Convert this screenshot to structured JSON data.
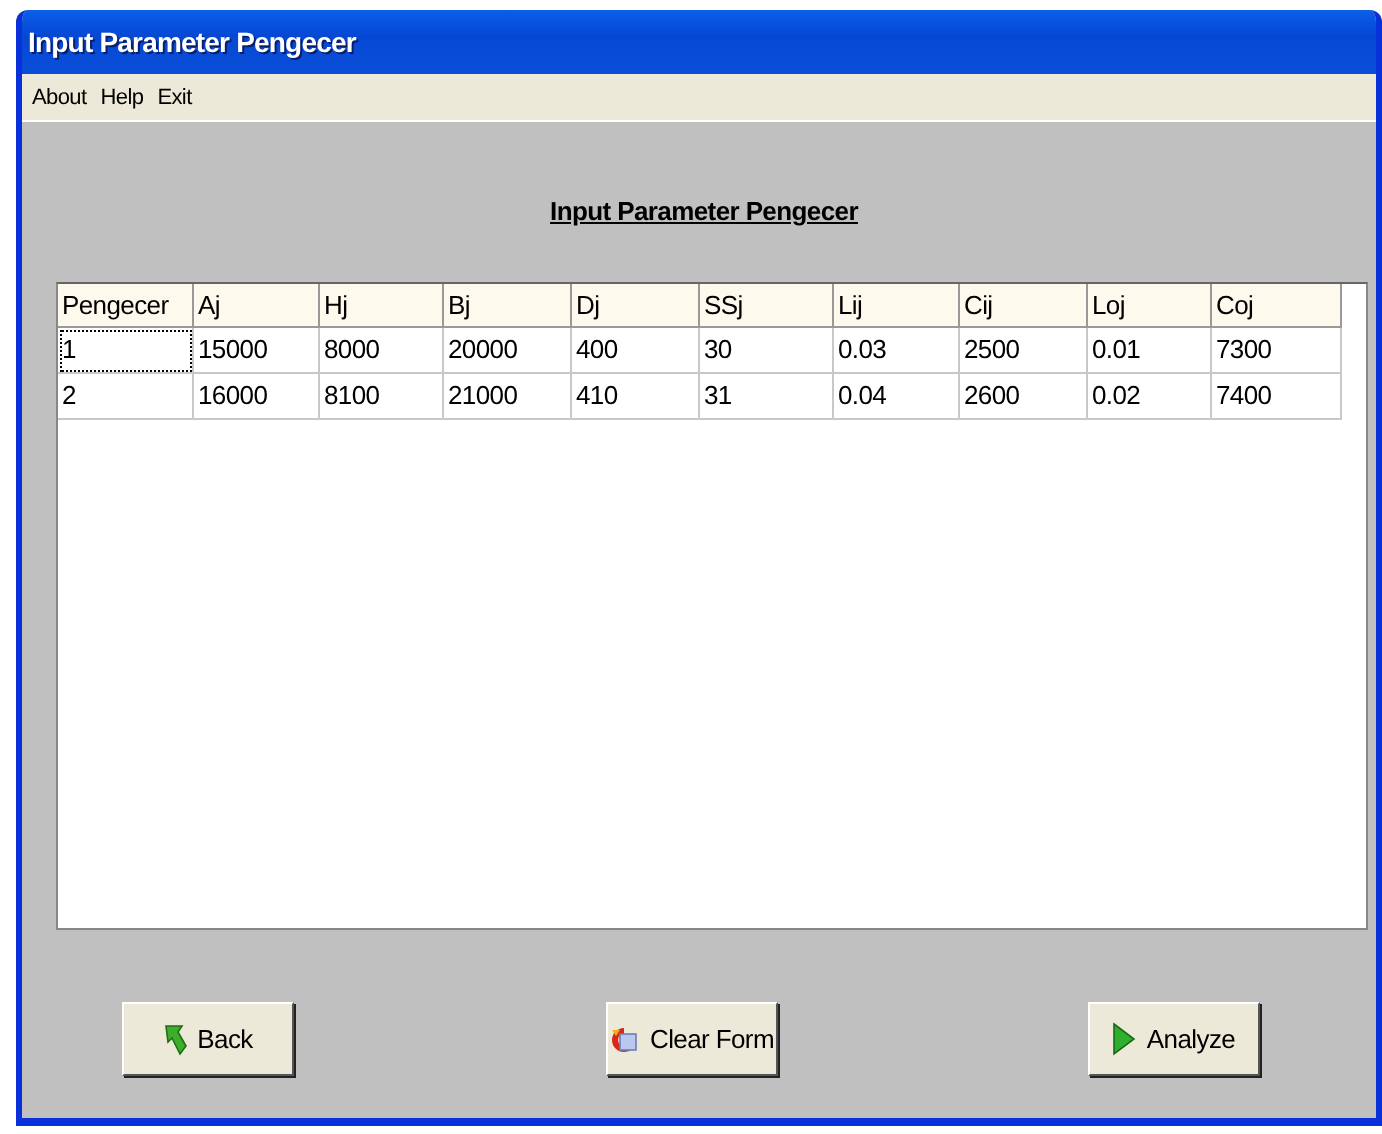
{
  "window": {
    "title": "Input Parameter Pengecer"
  },
  "menu": [
    "About",
    "Help",
    "Exit"
  ],
  "heading": "Input Parameter Pengecer",
  "table": {
    "columns": [
      "Pengecer",
      "Aj",
      "Hj",
      "Bj",
      "Dj",
      "SSj",
      "Lij",
      "Cij",
      "Loj",
      "Coj"
    ],
    "rows": [
      [
        "1",
        "15000",
        "8000",
        "20000",
        "400",
        "30",
        "0.03",
        "2500",
        "0.01",
        "7300"
      ],
      [
        "2",
        "16000",
        "8100",
        "21000",
        "410",
        "31",
        "0.04",
        "2600",
        "0.02",
        "7400"
      ]
    ]
  },
  "buttons": [
    {
      "kind": "back",
      "label": "Back"
    },
    {
      "kind": "clear",
      "label": "Clear Form"
    },
    {
      "kind": "analyze",
      "label": "Analyze"
    }
  ]
}
